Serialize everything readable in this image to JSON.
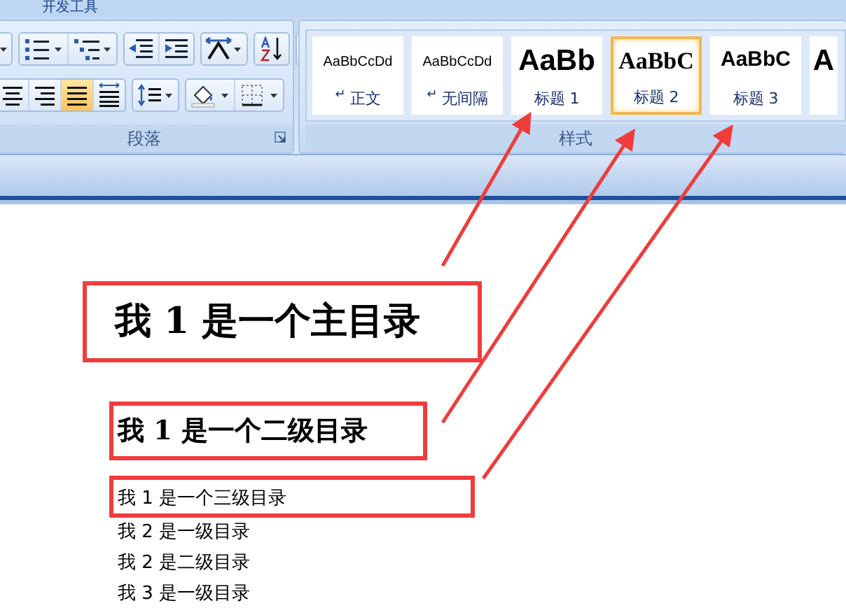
{
  "ribbon": {
    "tab_label": "开发工具",
    "paragraph_group": {
      "label": "段落",
      "alignment_buttons": [
        {
          "kind": "center",
          "selected": false
        },
        {
          "kind": "right",
          "selected": false
        },
        {
          "kind": "justify",
          "selected": true
        },
        {
          "kind": "distributed",
          "selected": false
        }
      ]
    },
    "styles_group": {
      "label": "样式",
      "styles": [
        {
          "kind": "normal",
          "preview": "AaBbCcDd",
          "mark": "↵",
          "label": "正文",
          "selected": false
        },
        {
          "kind": "normal",
          "preview": "AaBbCcDd",
          "mark": "↵",
          "label": "无间隔",
          "selected": false
        },
        {
          "kind": "heading1",
          "preview": "AaBb",
          "label": "标题 1",
          "selected": false
        },
        {
          "kind": "heading2",
          "preview": "AaBbC",
          "label": "标题 2",
          "selected": true
        },
        {
          "kind": "heading3",
          "preview": "AaBbC",
          "label": "标题 3",
          "selected": false
        },
        {
          "kind": "heading1",
          "preview": "A",
          "selected": false
        }
      ]
    }
  },
  "document": {
    "lines": [
      {
        "kind": "heading1",
        "text": "我 1 是一个主目录",
        "boxed": true
      },
      {
        "kind": "heading2",
        "text": "我 1 是一个二级目录",
        "boxed": true
      },
      {
        "kind": "heading3",
        "text": "我 1 是一个三级目录",
        "boxed": true
      },
      {
        "kind": "body",
        "text": "我 2 是一级目录",
        "boxed": false
      },
      {
        "kind": "body",
        "text": "我 2 是二级目录",
        "boxed": false
      },
      {
        "kind": "body",
        "text": "我 3 是一级目录",
        "boxed": false
      }
    ]
  }
}
